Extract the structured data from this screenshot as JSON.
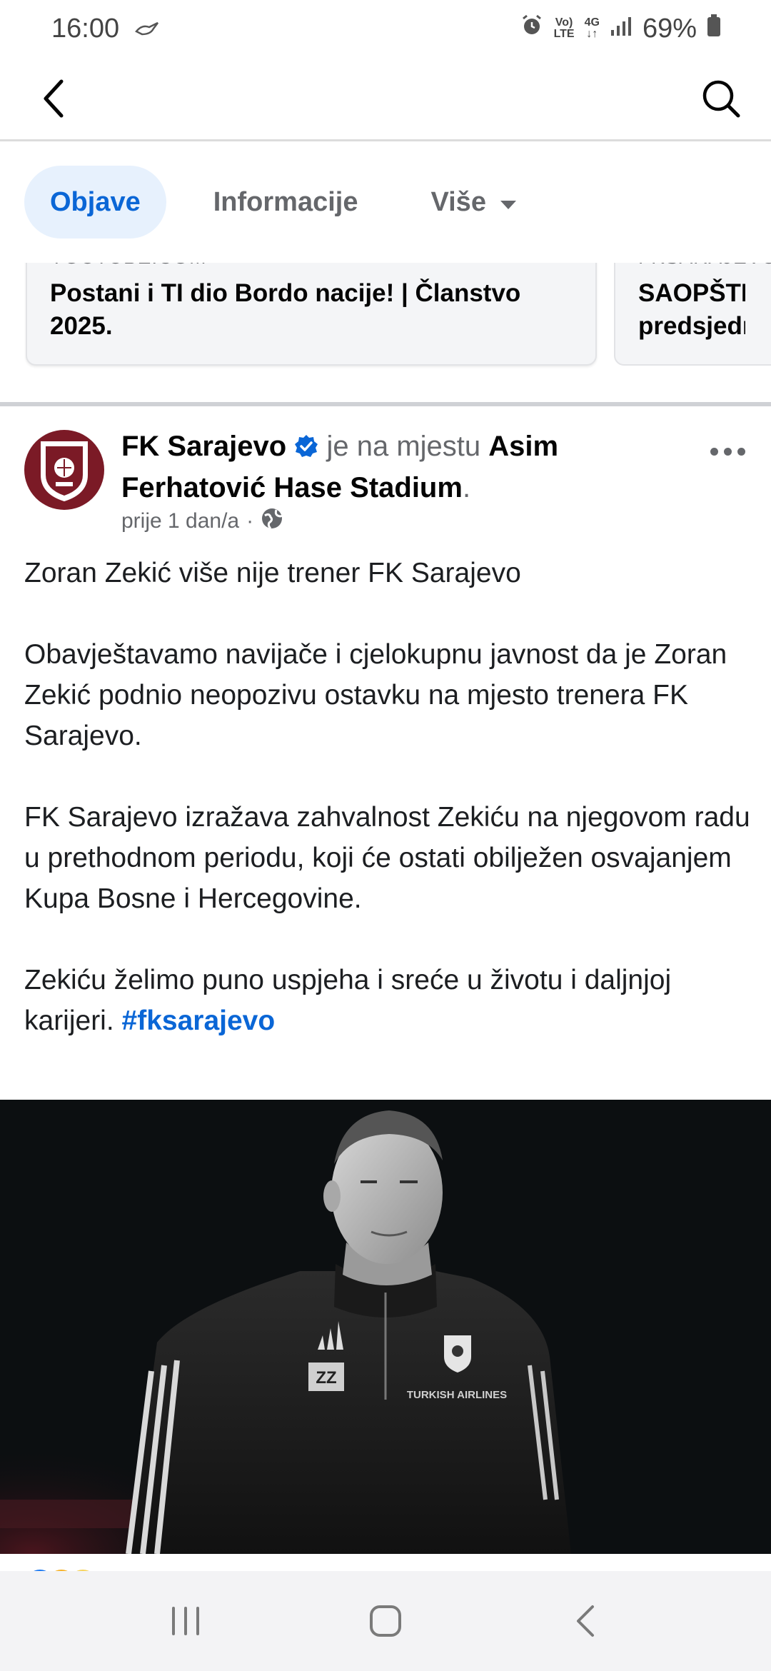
{
  "status_bar": {
    "time": "16:00",
    "volte_top": "Vo)",
    "volte_bottom": "LTE",
    "network": "4G",
    "battery": "69%"
  },
  "app_bar": {
    "back_icon": "chevron-left-icon",
    "search_icon": "search-icon"
  },
  "tabs": [
    {
      "label": "Objave",
      "active": true
    },
    {
      "label": "Informacije",
      "active": false
    },
    {
      "label": "Više",
      "active": false
    }
  ],
  "cards": [
    {
      "source": "YOUTUBE.COM",
      "title": "Postani i TI dio Bordo nacije! | Članstvo 2025."
    },
    {
      "source": "FKSARAJEVO",
      "title": "SAOPŠTENJE predsjednika"
    }
  ],
  "post": {
    "page_name": "FK Sarajevo",
    "location_prefix": "je na mjestu",
    "location": "Asim Ferhatović Hase Stadium",
    "location_suffix": ".",
    "time": "prije 1 dan/a",
    "separator": "·",
    "privacy_icon": "globe-icon",
    "paragraphs": [
      "Zoran Zekić više nije trener FK Sarajevo",
      "Obavještavamo navijače i cjelokupnu javnost da je Zoran Zekić podnio neopozivu ostavku na mjesto trenera FK Sarajevo.",
      "FK Sarajevo izražava zahvalnost Zekiću na njegovom radu u prethodnom periodu,  koji će ostati obilježen osvajanjem Kupa Bosne i Hercegovine.",
      "Zekiću želimo puno uspjeha i sreće u životu i daljnjoj karijeri."
    ],
    "hashtag": "#fksarajevo",
    "photo": {
      "initials_badge": "ZZ",
      "sponsor": "TURKISH AIRLINES"
    }
  },
  "colors": {
    "accent": "#0a66d6",
    "tab_active_bg": "#e7f1fd",
    "club_maroon": "#7b1a26"
  },
  "nav_bar": {
    "recents_icon": "recents-icon",
    "home_icon": "home-icon",
    "back_icon": "back-icon"
  }
}
